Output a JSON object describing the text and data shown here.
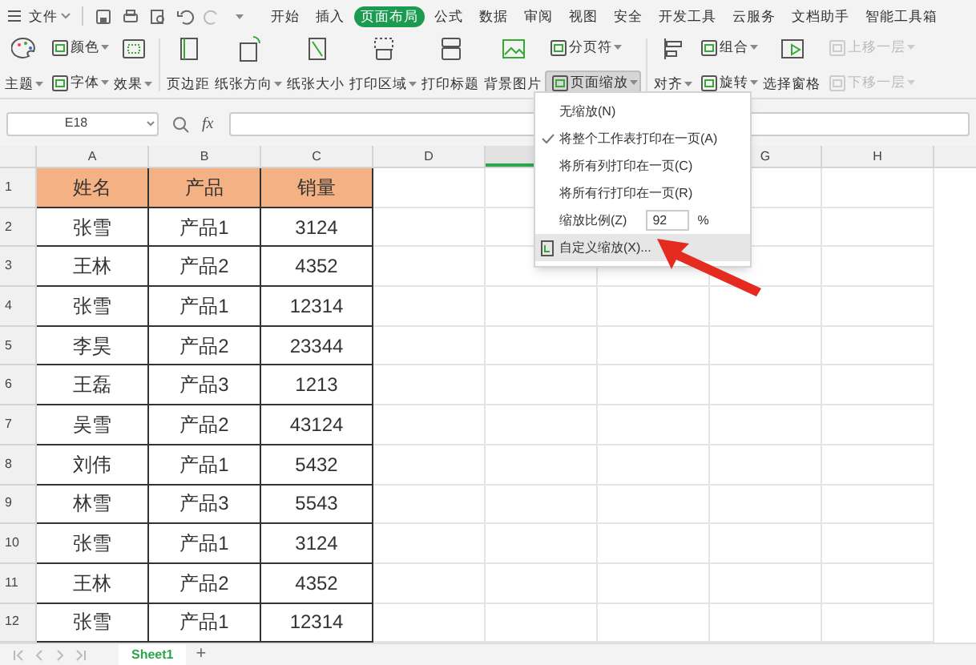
{
  "menu_bar": {
    "file_label": "文件",
    "tabs": [
      {
        "label": "开始",
        "selected": false
      },
      {
        "label": "插入",
        "selected": false
      },
      {
        "label": "页面布局",
        "selected": true
      },
      {
        "label": "公式",
        "selected": false
      },
      {
        "label": "数据",
        "selected": false
      },
      {
        "label": "审阅",
        "selected": false
      },
      {
        "label": "视图",
        "selected": false
      },
      {
        "label": "安全",
        "selected": false
      },
      {
        "label": "开发工具",
        "selected": false
      },
      {
        "label": "云服务",
        "selected": false
      },
      {
        "label": "文档助手",
        "selected": false
      },
      {
        "label": "智能工具箱",
        "selected": false
      }
    ]
  },
  "ribbon": {
    "groups": [
      {
        "columns": [
          {
            "items": [
              {
                "label": "主题",
                "kind": "large",
                "dropdown": true,
                "disabled": false,
                "pressed": false
              }
            ]
          },
          {
            "items": [
              {
                "label": "颜色",
                "kind": "small",
                "dropdown": true,
                "disabled": false,
                "pressed": false
              },
              {
                "label": "字体",
                "kind": "small",
                "dropdown": true,
                "disabled": false,
                "pressed": false
              }
            ]
          },
          {
            "items": [
              {
                "label": "效果",
                "kind": "large",
                "dropdown": true,
                "disabled": false,
                "pressed": false
              }
            ]
          }
        ]
      },
      {
        "columns": [
          {
            "items": [
              {
                "label": "页边距",
                "kind": "large",
                "dropdown": false,
                "disabled": false,
                "pressed": false
              }
            ]
          },
          {
            "items": [
              {
                "label": "纸张方向",
                "kind": "large",
                "dropdown": true,
                "disabled": false,
                "pressed": false
              }
            ]
          },
          {
            "items": [
              {
                "label": "纸张大小",
                "kind": "large",
                "dropdown": false,
                "disabled": false,
                "pressed": false
              }
            ]
          },
          {
            "items": [
              {
                "label": "打印区域",
                "kind": "large",
                "dropdown": true,
                "disabled": false,
                "pressed": false
              }
            ]
          },
          {
            "items": [
              {
                "label": "打印标题",
                "kind": "large",
                "dropdown": false,
                "disabled": false,
                "pressed": false
              }
            ]
          },
          {
            "items": [
              {
                "label": "背景图片",
                "kind": "large",
                "dropdown": false,
                "disabled": false,
                "pressed": false
              }
            ]
          },
          {
            "items": [
              {
                "label": "分页符",
                "kind": "small",
                "dropdown": true,
                "disabled": false,
                "pressed": false
              },
              {
                "label": "页面缩放",
                "kind": "small",
                "dropdown": true,
                "disabled": false,
                "pressed": true
              }
            ]
          }
        ]
      },
      {
        "columns": [
          {
            "items": [
              {
                "label": "对齐",
                "kind": "large",
                "dropdown": true,
                "disabled": false,
                "pressed": false
              }
            ]
          },
          {
            "items": [
              {
                "label": "组合",
                "kind": "small",
                "dropdown": true,
                "disabled": false,
                "pressed": false
              },
              {
                "label": "旋转",
                "kind": "small",
                "dropdown": true,
                "disabled": false,
                "pressed": false
              }
            ]
          },
          {
            "items": [
              {
                "label": "选择窗格",
                "kind": "large",
                "dropdown": false,
                "disabled": false,
                "pressed": false
              }
            ]
          },
          {
            "items": [
              {
                "label": "上移一层",
                "kind": "small",
                "dropdown": true,
                "disabled": true,
                "pressed": false
              },
              {
                "label": "下移一层",
                "kind": "small",
                "dropdown": true,
                "disabled": true,
                "pressed": false
              }
            ]
          }
        ]
      }
    ]
  },
  "formula_bar": {
    "name_box": "E18",
    "fx_label": "fx"
  },
  "sheet": {
    "columns": [
      {
        "label": "A",
        "selected": false
      },
      {
        "label": "B",
        "selected": false
      },
      {
        "label": "C",
        "selected": false
      },
      {
        "label": "D",
        "selected": false
      },
      {
        "selected": true
      },
      {},
      {
        "label": "G",
        "selected": false
      },
      {
        "label": "H",
        "selected": false
      }
    ],
    "rows": [
      {
        "number": "1",
        "cells": [
          "姓名",
          "产品",
          "销量"
        ],
        "header": true
      },
      {
        "number": "2",
        "cells": [
          "张雪",
          "产品1",
          "3124"
        ],
        "header": false
      },
      {
        "number": "3",
        "cells": [
          "王林",
          "产品2",
          "4352"
        ],
        "header": false
      },
      {
        "number": "4",
        "cells": [
          "张雪",
          "产品1",
          "12314"
        ],
        "header": false
      },
      {
        "number": "5",
        "cells": [
          "李昊",
          "产品2",
          "23344"
        ],
        "header": false
      },
      {
        "number": "6",
        "cells": [
          "王磊",
          "产品3",
          "1213"
        ],
        "header": false
      },
      {
        "number": "7",
        "cells": [
          "吴雪",
          "产品2",
          "43124"
        ],
        "header": false
      },
      {
        "number": "8",
        "cells": [
          "刘伟",
          "产品1",
          "5432"
        ],
        "header": false
      },
      {
        "number": "9",
        "cells": [
          "林雪",
          "产品3",
          "5543"
        ],
        "header": false
      },
      {
        "number": "10",
        "cells": [
          "张雪",
          "产品1",
          "3124"
        ],
        "header": false
      },
      {
        "number": "11",
        "cells": [
          "王林",
          "产品2",
          "4352"
        ],
        "header": false
      },
      {
        "number": "12",
        "cells": [
          "张雪",
          "产品1",
          "12314"
        ],
        "header": false
      }
    ]
  },
  "zoom_menu": {
    "items": [
      {
        "kind": "item",
        "label": "无缩放(N)",
        "checked": false,
        "highlighted": false
      },
      {
        "kind": "item",
        "label": "将整个工作表打印在一页(A)",
        "checked": true,
        "highlighted": false
      },
      {
        "kind": "item",
        "label": "将所有列打印在一页(C)",
        "checked": false,
        "highlighted": false
      },
      {
        "kind": "item",
        "label": "将所有行打印在一页(R)",
        "checked": false,
        "highlighted": false
      },
      {
        "kind": "scale",
        "label": "缩放比例(Z)",
        "value": "92",
        "unit": "%",
        "checked": false,
        "highlighted": false
      },
      {
        "kind": "custom",
        "label": "自定义缩放(X)...",
        "checked": false,
        "highlighted": true
      }
    ]
  },
  "sheet_tabs": [
    {
      "label": "Sheet1",
      "selected": true
    }
  ],
  "add_sheet_label": "+"
}
